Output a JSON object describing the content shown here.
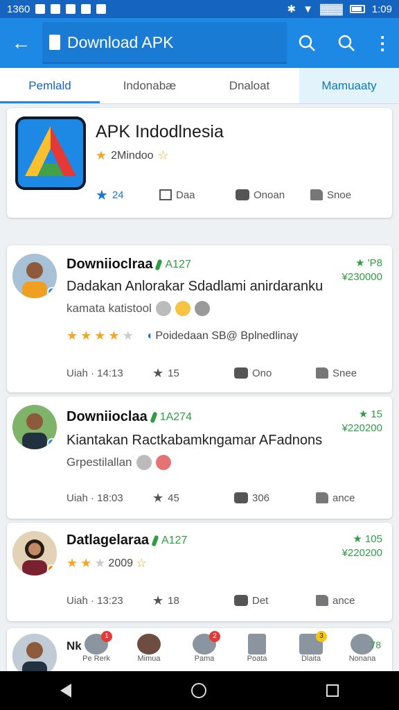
{
  "status": {
    "time_left": "1360",
    "time_right": "1:09",
    "network": "▓▓▓"
  },
  "app_bar": {
    "title": "Download APK"
  },
  "tabs": [
    {
      "label": "Pemlald"
    },
    {
      "label": "Indonabæ"
    },
    {
      "label": "Dnaloat"
    },
    {
      "label": "Mamuaaty"
    }
  ],
  "app": {
    "name": "APK Indodlnesia",
    "subtitle": "2Mindoo",
    "rating": "24",
    "share_label": "Daa",
    "comment_label": "Onoan",
    "like_label": "Snoe"
  },
  "reviews": [
    {
      "name": "Downiioclraa",
      "date": "A127",
      "score_top": "★ 'P8",
      "score_bottom": "¥230000",
      "text": "Dadakan Anlorakar Sdadlami anirdaranku",
      "sub": "kamata katistool",
      "extra": "Poidedaan  SB@ Bplnedlinay",
      "meta_date": "Uiah · 14:13",
      "stars": "15",
      "comments": "Ono",
      "likes": "Snee"
    },
    {
      "name": "Downiioclaa",
      "date": "1A274",
      "score_top": "★ 15",
      "score_bottom": "¥220200",
      "text": "Kiantakan Ractkabamkngamar AFadnons",
      "sub": "Grpestilallan",
      "meta_date": "Uiah · 18:03",
      "stars": "45",
      "comments": "306",
      "likes": "ance"
    },
    {
      "name": "Datlagelaraa",
      "date": "A127",
      "score_top": "★ 105",
      "score_bottom": "¥220200",
      "rating_text": "2009",
      "meta_date": "Uiah · 13:23",
      "stars": "18",
      "comments": "Det",
      "likes": "ance"
    }
  ],
  "bottom_peek": {
    "label": "Nk",
    "items": [
      {
        "label": "Pe Rerk",
        "badge": "1"
      },
      {
        "label": "Mimua",
        "badge": ""
      },
      {
        "label": "Pama",
        "badge": "2"
      },
      {
        "label": "Poata",
        "badge": ""
      },
      {
        "label": "Dlaita",
        "badge": "3"
      },
      {
        "label": "Nonana",
        "badge": ""
      }
    ],
    "right_count": "78"
  }
}
